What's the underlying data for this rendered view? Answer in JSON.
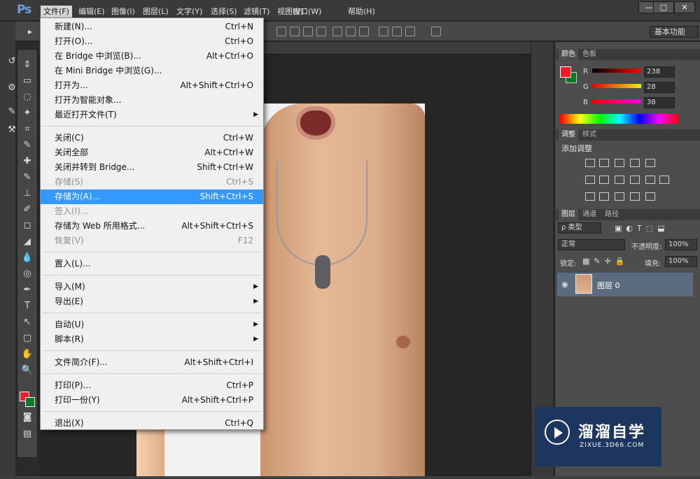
{
  "app": {
    "logo": "Ps"
  },
  "menubar": {
    "items": [
      "文件(F)",
      "编辑(E)",
      "图像(I)",
      "图层(L)",
      "文字(Y)",
      "选择(S)",
      "滤镜(T)",
      "视图(V)",
      "窗口(W)",
      "帮助(H)"
    ],
    "active": "文件(F)"
  },
  "window_controls": {
    "minimize": "—",
    "maximize": "□",
    "close": "✕"
  },
  "options_bar": {
    "workspace": "基本功能"
  },
  "file_menu": [
    {
      "label": "新建(N)...",
      "shortcut": "Ctrl+N"
    },
    {
      "label": "打开(O)...",
      "shortcut": "Ctrl+O"
    },
    {
      "label": "在 Bridge 中浏览(B)...",
      "shortcut": "Alt+Ctrl+O"
    },
    {
      "label": "在 Mini Bridge 中浏览(G)...",
      "shortcut": ""
    },
    {
      "label": "打开为...",
      "shortcut": "Alt+Shift+Ctrl+O"
    },
    {
      "label": "打开为智能对象...",
      "shortcut": ""
    },
    {
      "label": "最近打开文件(T)",
      "shortcut": "",
      "submenu": true
    },
    {
      "label": "关闭(C)",
      "shortcut": "Ctrl+W"
    },
    {
      "label": "关闭全部",
      "shortcut": "Alt+Ctrl+W"
    },
    {
      "label": "关闭并转到 Bridge...",
      "shortcut": "Shift+Ctrl+W"
    },
    {
      "label": "存储(S)",
      "shortcut": "Ctrl+S",
      "disabled": true
    },
    {
      "label": "存储为(A)...",
      "shortcut": "Shift+Ctrl+S",
      "highlighted": true
    },
    {
      "label": "签入(I)...",
      "shortcut": "",
      "disabled": true
    },
    {
      "label": "存储为 Web 所用格式...",
      "shortcut": "Alt+Shift+Ctrl+S"
    },
    {
      "label": "恢复(V)",
      "shortcut": "F12",
      "disabled": true
    },
    {
      "label": "置入(L)...",
      "shortcut": ""
    },
    {
      "label": "导入(M)",
      "shortcut": "",
      "submenu": true
    },
    {
      "label": "导出(E)",
      "shortcut": "",
      "submenu": true
    },
    {
      "label": "自动(U)",
      "shortcut": "",
      "submenu": true
    },
    {
      "label": "脚本(R)",
      "shortcut": "",
      "submenu": true
    },
    {
      "label": "文件简介(F)...",
      "shortcut": "Alt+Shift+Ctrl+I"
    },
    {
      "label": "打印(P)...",
      "shortcut": "Ctrl+P"
    },
    {
      "label": "打印一份(Y)",
      "shortcut": "Alt+Shift+Ctrl+P"
    },
    {
      "label": "退出(X)",
      "shortcut": "Ctrl+Q"
    }
  ],
  "color_panel": {
    "tabs": [
      "颜色",
      "色板"
    ],
    "channels": [
      {
        "name": "R",
        "value": "238"
      },
      {
        "name": "G",
        "value": "28"
      },
      {
        "name": "B",
        "value": "38"
      }
    ],
    "foreground": "#ee1c26",
    "background": "#0a7a2a"
  },
  "adjustments_panel": {
    "tabs": [
      "调整",
      "样式"
    ],
    "title": "添加调整"
  },
  "layers_panel": {
    "tabs": [
      "图层",
      "通道",
      "路径"
    ],
    "filter": "ρ 类型",
    "blend_mode": "正常",
    "opacity_label": "不透明度:",
    "opacity": "100%",
    "lock_label": "锁定:",
    "fill_label": "填充:",
    "fill": "100%",
    "layer_name": "图层 0"
  },
  "watermark": {
    "title": "溜溜自学",
    "url": "ZIXUE.3D66.COM"
  }
}
